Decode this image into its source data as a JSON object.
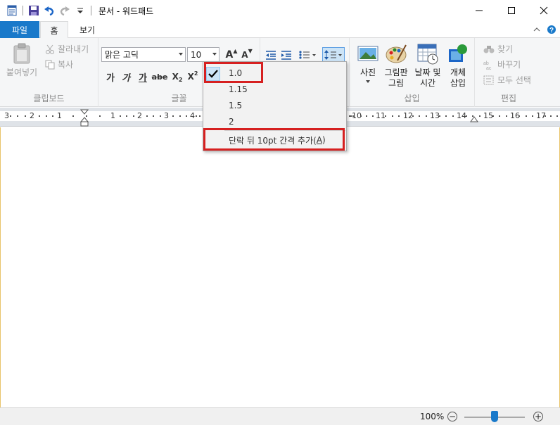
{
  "window": {
    "title": "문서 - 워드패드",
    "controls": [
      "minimize",
      "maximize",
      "close"
    ]
  },
  "quick_access": {
    "icons": [
      "wordpad-icon",
      "save-icon",
      "undo-icon",
      "redo-icon",
      "customize-icon"
    ]
  },
  "tabs": [
    {
      "label": "파일"
    },
    {
      "label": "홈"
    },
    {
      "label": "보기"
    }
  ],
  "ribbon": {
    "clipboard": {
      "label": "클립보드",
      "paste": "붙여넣기",
      "cut": "잘라내기",
      "copy": "복사"
    },
    "font": {
      "label": "글꼴",
      "font_name": "맑은 고딕",
      "font_size": "10",
      "grow": "A",
      "shrink": "A",
      "bold": "가",
      "italic": "가",
      "underline": "가",
      "strike": "abe",
      "subscript": "X",
      "superscript": "X",
      "sub_mark": "2",
      "sup_mark": "2"
    },
    "insert": {
      "label": "삽입",
      "picture": "사진",
      "paint_line1": "그림판",
      "paint_line2": "그림",
      "datetime_line1": "날짜 및",
      "datetime_line2": "시간",
      "object_line1": "개체",
      "object_line2": "삽입"
    },
    "edit": {
      "label": "편집",
      "find": "찾기",
      "replace": "바꾸기",
      "select_all": "모두 선택"
    }
  },
  "line_spacing_menu": {
    "items": [
      "1.0",
      "1.15",
      "1.5",
      "2"
    ],
    "selected": "1.0",
    "extra_prefix": "단락 뒤 10pt 간격 추가(",
    "extra_key": "A",
    "extra_suffix": ")"
  },
  "ruler": {
    "numbers": [
      "3",
      "2",
      "1",
      "1",
      "2",
      "3",
      "4",
      "10",
      "11",
      "12",
      "13",
      "14",
      "15",
      "16",
      "17"
    ]
  },
  "status": {
    "zoom": "100%",
    "zoom_value": 100
  },
  "colors": {
    "accent": "#1979ca",
    "highlight": "#d62020",
    "check_bg": "#cce4f7"
  }
}
